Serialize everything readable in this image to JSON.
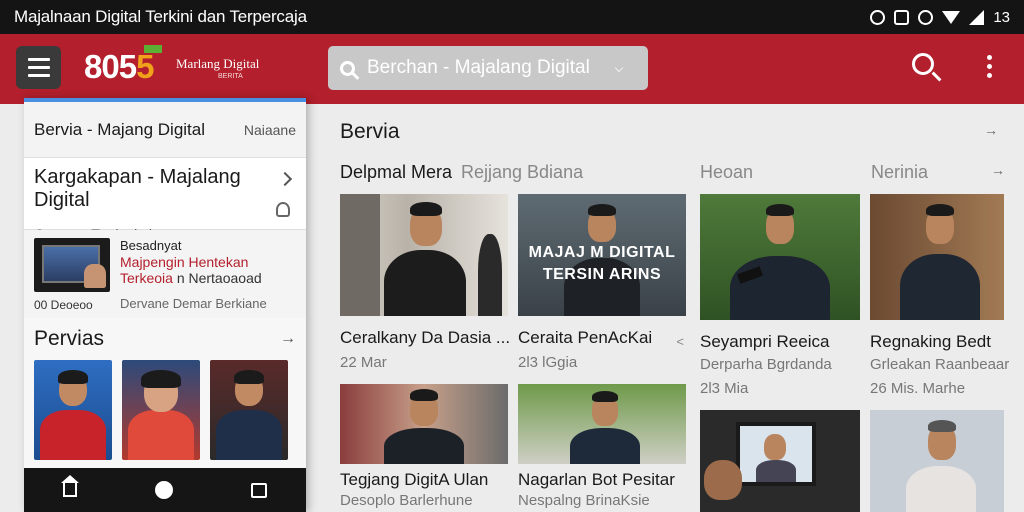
{
  "status_bar": {
    "title": "Majalnaan Digital Terkini dan Terpercaja",
    "battery": "13"
  },
  "app_bar": {
    "logo_main": "805",
    "logo_highlight": "5",
    "brand_name": "Marlang Digital",
    "brand_tagline": "BERITA",
    "search_placeholder": "Berchan - Majalang Digital"
  },
  "drawer": {
    "header_title": "Bervia - Majang Digital",
    "header_right": "Naiaane",
    "card": {
      "title": "Kargakapan - Majalang Digital",
      "subtitle": "Cengraa Terdankniema"
    },
    "story": {
      "line1": "Besadnyat",
      "line2": "Majpengin Hentekan",
      "line3a": "Terkeoia",
      "line3b": "n Nertaoaoad",
      "tag": "00 Deoeoo",
      "meta": "Dervane Demar Berkiane"
    },
    "section": {
      "title": "Pervias",
      "arrow": "→"
    }
  },
  "main": {
    "heading": "Bervia",
    "heading_arrow": "→",
    "tabs": [
      {
        "label": "Delpmal Mera",
        "active": true
      },
      {
        "label": "Rejjang Bdiana",
        "active": false
      },
      {
        "label": "Heoan",
        "active": false
      },
      {
        "label": "Nerinia",
        "active": false
      }
    ],
    "tab_arrow": "→",
    "cards": [
      {
        "title": "Ceralkany Da Dasia ...",
        "meta": "22 Mar",
        "share": ""
      },
      {
        "title": "Ceraita PenAcKai",
        "meta": "2l3 lGgia",
        "share": "<",
        "overlay_line1": "MAJAJ M DIGITAL",
        "overlay_line2": "TERSIN ARINS"
      },
      {
        "title": "Seyampri Reeica",
        "meta": "Derparha Bgrdanda",
        "meta2": "2l3 Mia"
      },
      {
        "title": "Regnaking Bedt",
        "meta": "Grleakan Raanbeaar",
        "meta2": "26 Mis. Marhe"
      },
      {
        "title": "Tegjang DigitA Ulan",
        "meta": "Desoplo Barlerhune"
      },
      {
        "title": "Nagarlan Bot Pesitar",
        "meta": "Nespalng BrinaKsie"
      }
    ]
  }
}
